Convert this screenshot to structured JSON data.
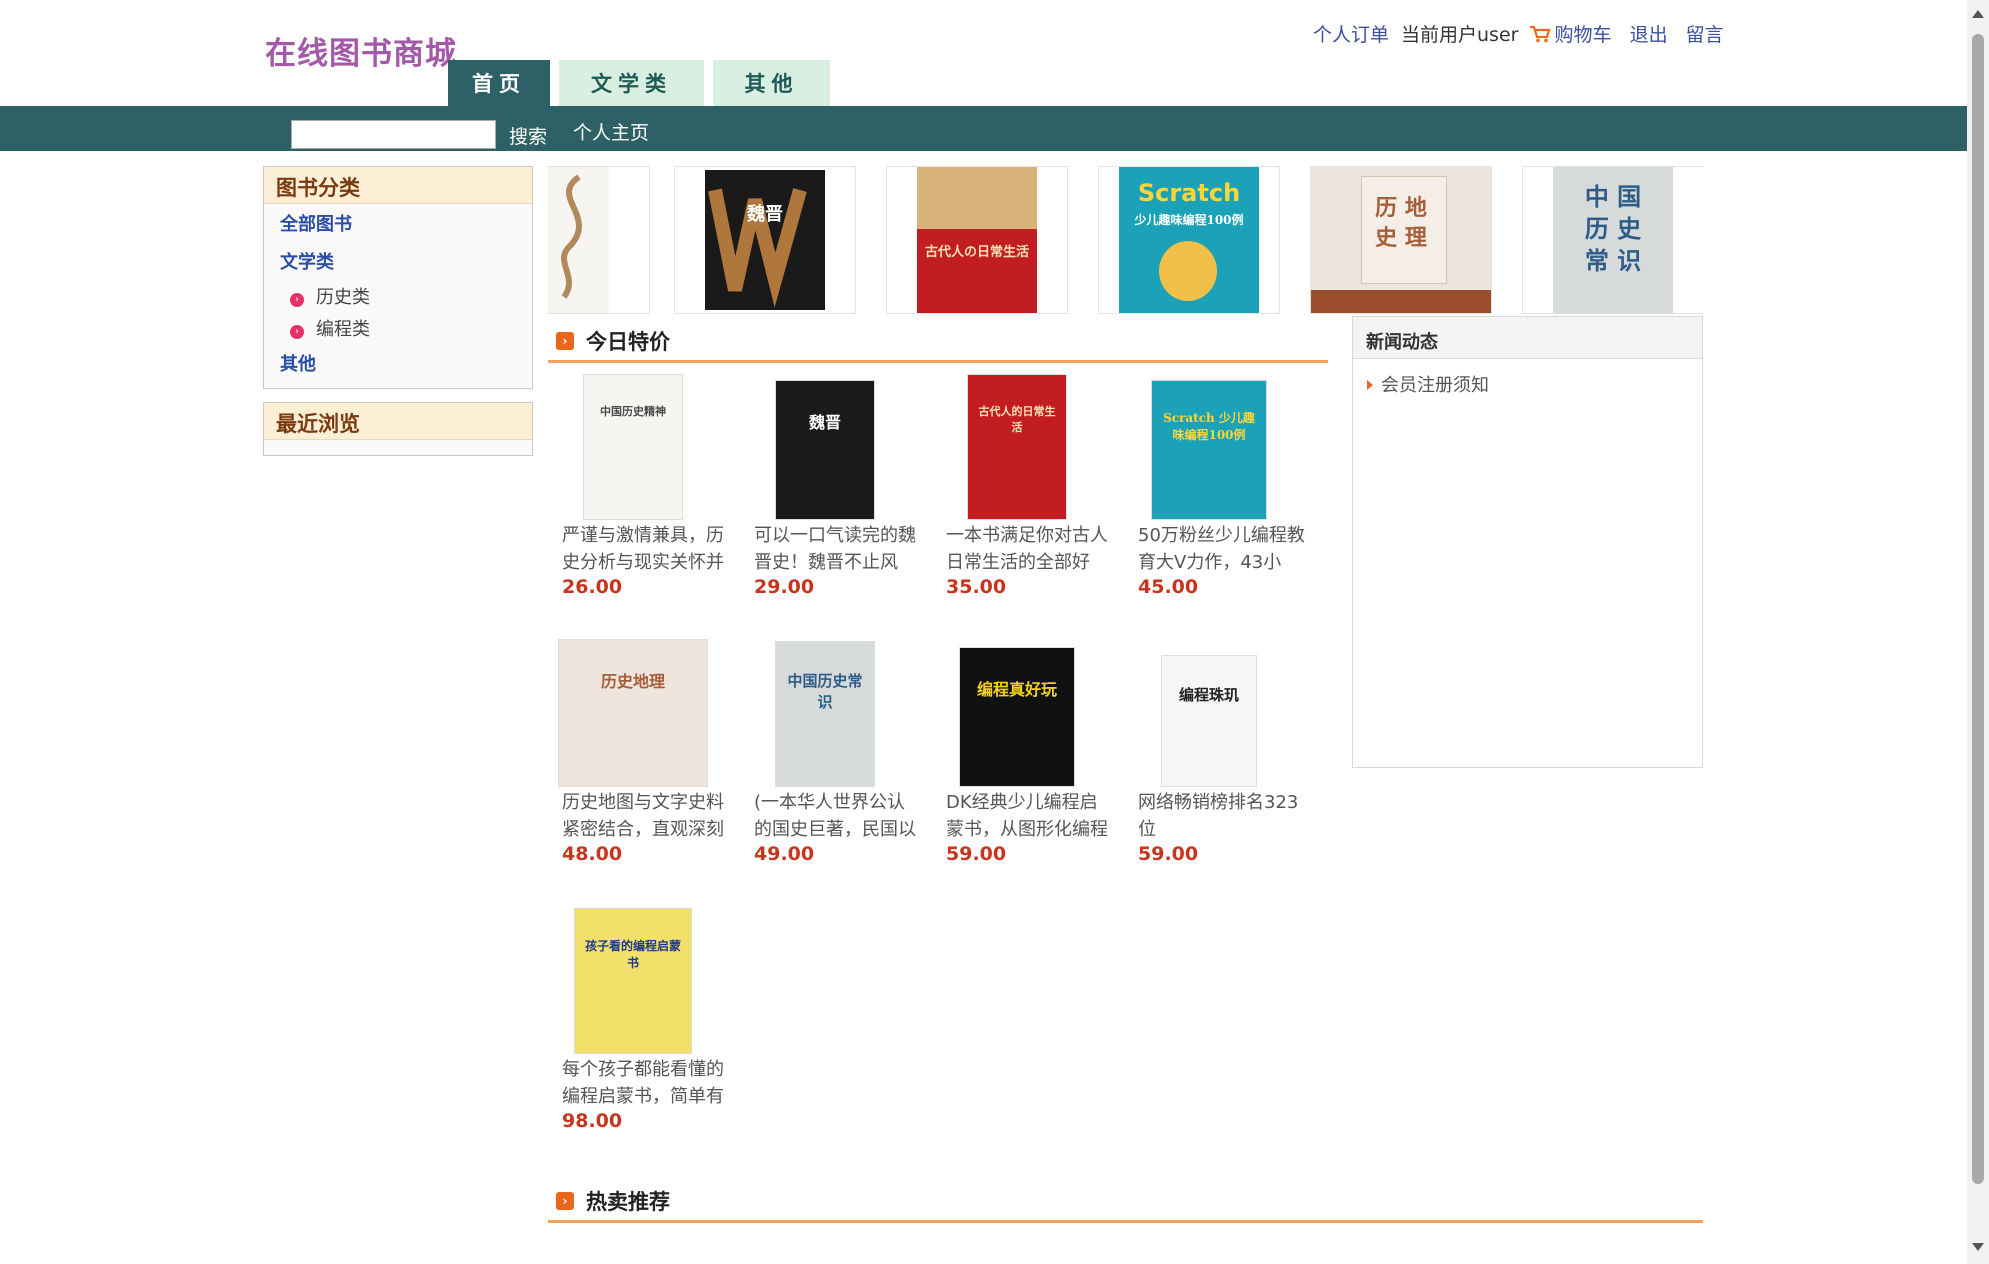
{
  "header": {
    "site_title": "在线图书商城",
    "nav": {
      "orders": "个人订单",
      "current_user": "当前用户user",
      "cart": "购物车",
      "logout": "退出",
      "message": "留言"
    },
    "tabs": [
      {
        "label": "首页",
        "active": true
      },
      {
        "label": "文学类",
        "active": false
      },
      {
        "label": "其他",
        "active": false
      }
    ],
    "search": {
      "value": "",
      "button": "搜索"
    },
    "home_link": "个人主页"
  },
  "sidebar": {
    "categories_title": "图书分类",
    "items": [
      {
        "label": "全部图书",
        "level": 1
      },
      {
        "label": "文学类",
        "level": 1
      },
      {
        "label": "历史类",
        "level": 2
      },
      {
        "label": "编程类",
        "level": 2
      },
      {
        "label": "其他",
        "level": 1
      }
    ],
    "recent_title": "最近浏览"
  },
  "slider_covers": [
    "中国历史精神",
    "魏晋",
    "古代人的日常生活",
    "Scratch 少儿趣味编程100例",
    "历史地理",
    "中国历史常识"
  ],
  "today_deals": {
    "title": "今日特价",
    "products": [
      {
        "cover": "中国历史精神",
        "desc": "严谨与激情兼具，历史分析与现实关怀并",
        "price": "26.00"
      },
      {
        "cover": "魏晋",
        "desc": "可以一口气读完的魏晋史！魏晋不止风",
        "price": "29.00"
      },
      {
        "cover": "古代人的日常生活",
        "desc": "一本书满足你对古人日常生活的全部好",
        "price": "35.00"
      },
      {
        "cover": "Scratch 少儿趣味编程100例",
        "desc": "50万粉丝少儿编程教育大V力作，43小",
        "price": "45.00"
      },
      {
        "cover": "历史地理",
        "desc": "历史地图与文字史料紧密结合，直观深刻",
        "price": "48.00"
      },
      {
        "cover": "中国历史常识",
        "desc": "(一本华人世界公认的国史巨著，民国以",
        "price": "49.00"
      },
      {
        "cover": "编程真好玩",
        "desc": "DK经典少儿编程启蒙书，从图形化编程",
        "price": "59.00"
      },
      {
        "cover": "编程珠玑",
        "desc": "网络畅销榜排名323位",
        "price": "59.00"
      },
      {
        "cover": "孩子看的编程启蒙书",
        "desc": "每个孩子都能看懂的编程启蒙书，简单有",
        "price": "98.00"
      }
    ]
  },
  "news": {
    "title": "新闻动态",
    "items": [
      "会员注册须知"
    ]
  },
  "hot": {
    "title": "热卖推荐"
  }
}
